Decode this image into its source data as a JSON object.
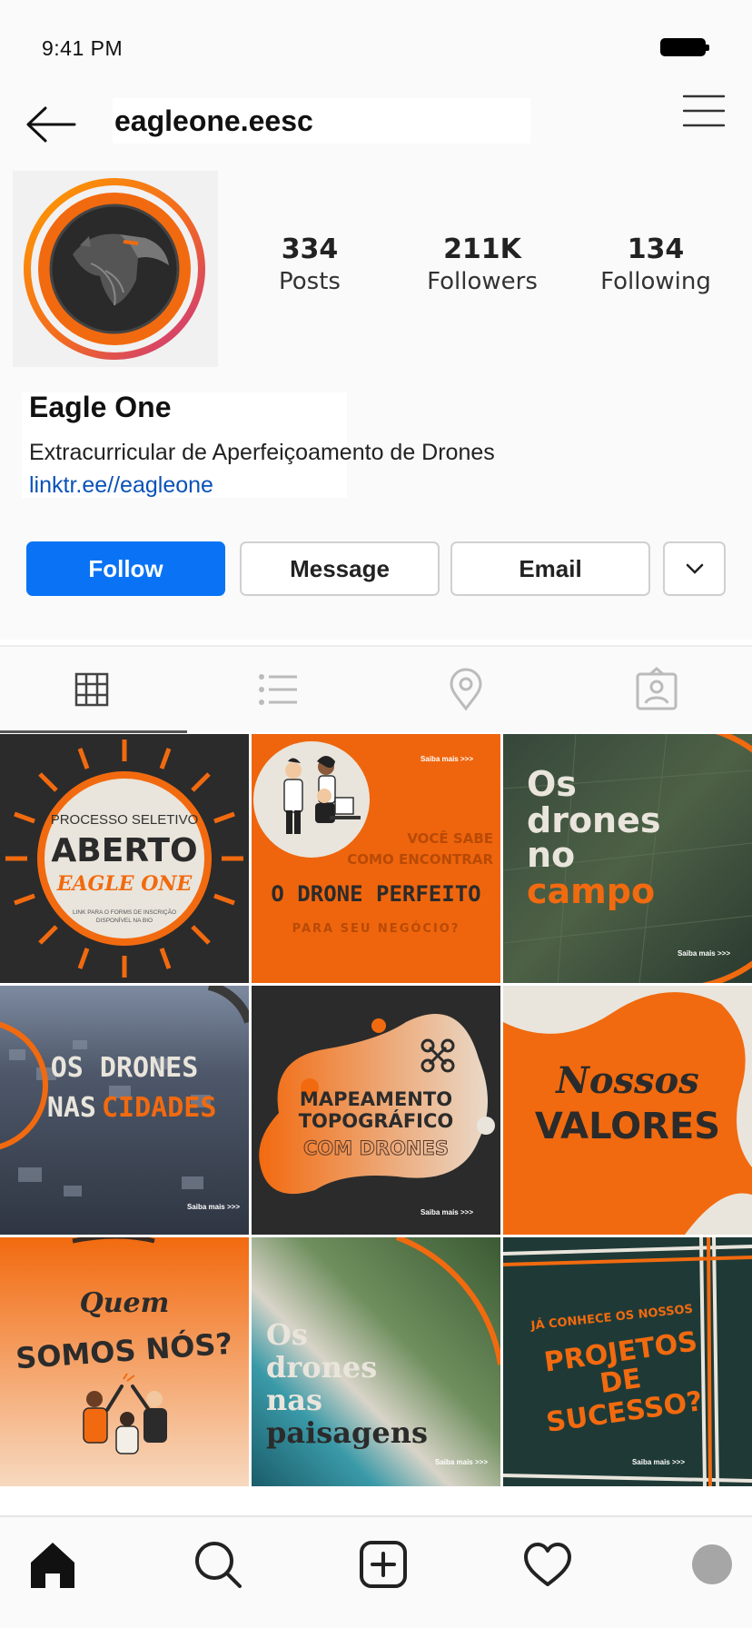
{
  "status": {
    "time": "9:41 PM"
  },
  "header": {
    "username": "eagleone.eesc"
  },
  "profile": {
    "stats": [
      {
        "value": "334",
        "label": "Posts"
      },
      {
        "value": "211K",
        "label": "Followers"
      },
      {
        "value": "134",
        "label": "Following"
      }
    ],
    "name": "Eagle One",
    "bio": "Extracurricular de Aperfeiçoamento de Drones",
    "link": "linktr.ee//eagleone"
  },
  "actions": {
    "follow": "Follow",
    "message": "Message",
    "email": "Email"
  },
  "posts": [
    {
      "lines": [
        "PROCESSO SELETIVO",
        "ABERTO",
        "EAGLE ONE",
        "LINK PARA O FORMS DE INSCRIÇÃO",
        "DISPONÍVEL NA BIO"
      ]
    },
    {
      "lines": [
        "Saiba mais >>>",
        "VOCÊ SABE",
        "COMO ENCONTRAR",
        "O DRONE PERFEITO",
        "PARA SEU NEGÓCIO?"
      ]
    },
    {
      "lines": [
        "Os",
        "drones",
        "no",
        "campo",
        "Saiba mais >>>"
      ]
    },
    {
      "lines": [
        "OS DRONES",
        "NAS",
        "CIDADES",
        "Saiba mais >>>"
      ]
    },
    {
      "lines": [
        "MAPEAMENTO",
        "TOPOGRÁFICO",
        "COM DRONES",
        "Saiba mais >>>"
      ]
    },
    {
      "lines": [
        "Nossos",
        "VALORES"
      ]
    },
    {
      "lines": [
        "Quem",
        "SOMOS NÓS?"
      ]
    },
    {
      "lines": [
        "Os",
        "drones",
        "nas",
        "paisagens",
        "Saiba mais >>>"
      ]
    },
    {
      "lines": [
        "JÁ CONHECE OS NOSSOS",
        "PROJETOS",
        "DE",
        "SUCESSO?",
        "Saiba mais >>>"
      ]
    }
  ],
  "colors": {
    "accent": "#f26a0f",
    "dark": "#2b2b2b",
    "follow": "#0a73f5",
    "link": "#0a52b8"
  }
}
